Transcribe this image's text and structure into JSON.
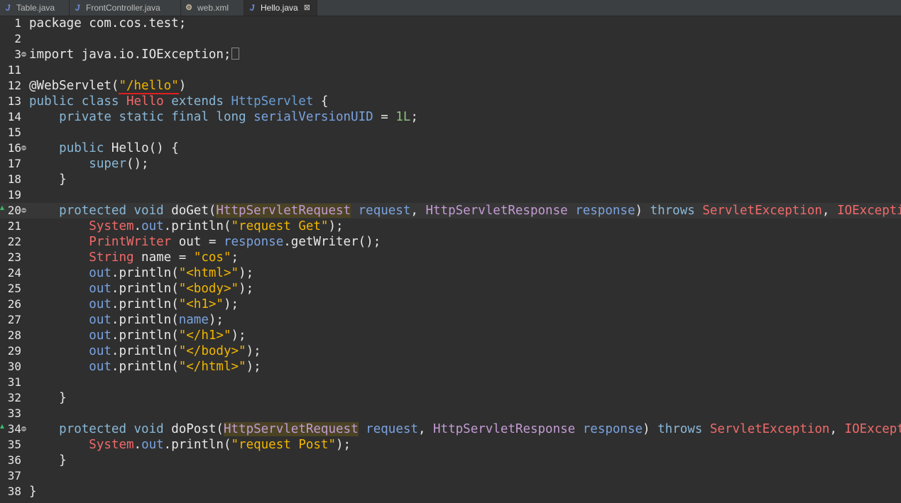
{
  "tabs": [
    {
      "icon": "J",
      "label": "Table.java"
    },
    {
      "icon": "J",
      "label": "FrontController.java"
    },
    {
      "icon": "xml",
      "label": "web.xml"
    },
    {
      "icon": "J",
      "label": "Hello.java",
      "close": "⊠"
    }
  ],
  "lines": [
    {
      "n": "1",
      "parts": [
        {
          "t": "package com.cos.test;"
        }
      ]
    },
    {
      "n": "2",
      "parts": []
    },
    {
      "n": "3",
      "parts": [
        {
          "t": "import java.io.IOException;"
        }
      ]
    },
    {
      "n": "11",
      "parts": []
    },
    {
      "n": "12",
      "parts": [
        {
          "t": "@WebServlet("
        },
        {
          "t": "\"/hello\"",
          "c": "str"
        },
        {
          "t": ")"
        }
      ]
    },
    {
      "n": "13",
      "parts": [
        {
          "t": "public class ",
          "c": "kw"
        },
        {
          "t": "Hello",
          "c": "typ"
        },
        {
          "t": " extends ",
          "c": "kw"
        },
        {
          "t": "HttpServlet",
          "c": "cls"
        },
        {
          "t": " {"
        }
      ]
    },
    {
      "n": "14",
      "parts": [
        {
          "t": "    "
        },
        {
          "t": "private static final long ",
          "c": "kw"
        },
        {
          "t": "serialVersionUID",
          "c": "var"
        },
        {
          "t": " = "
        },
        {
          "t": "1L",
          "c": "num"
        },
        {
          "t": ";"
        }
      ]
    },
    {
      "n": "15",
      "parts": []
    },
    {
      "n": "16",
      "parts": [
        {
          "t": "    "
        },
        {
          "t": "public ",
          "c": "kw"
        },
        {
          "t": "Hello() {"
        }
      ]
    },
    {
      "n": "17",
      "parts": [
        {
          "t": "        "
        },
        {
          "t": "super",
          "c": "kw"
        },
        {
          "t": "();"
        }
      ]
    },
    {
      "n": "18",
      "parts": [
        {
          "t": "    }"
        }
      ]
    },
    {
      "n": "19",
      "parts": []
    },
    {
      "n": "20",
      "parts": [
        {
          "t": "    "
        },
        {
          "t": "protected void ",
          "c": "kw"
        },
        {
          "t": "doGet("
        },
        {
          "t": "HttpServletRequest",
          "c": "tpr"
        },
        {
          "t": " "
        },
        {
          "t": "request",
          "c": "var"
        },
        {
          "t": ", "
        },
        {
          "t": "HttpServletResponse",
          "c": "tpr"
        },
        {
          "t": " "
        },
        {
          "t": "response",
          "c": "var"
        },
        {
          "t": ") "
        },
        {
          "t": "throws ",
          "c": "kw"
        },
        {
          "t": "ServletException",
          "c": "typ"
        },
        {
          "t": ", "
        },
        {
          "t": "IOException",
          "c": "typ"
        },
        {
          "t": " {"
        }
      ]
    },
    {
      "n": "21",
      "parts": [
        {
          "t": "        "
        },
        {
          "t": "System",
          "c": "typ"
        },
        {
          "t": "."
        },
        {
          "t": "out",
          "c": "var"
        },
        {
          "t": ".println("
        },
        {
          "t": "\"request Get\"",
          "c": "str"
        },
        {
          "t": ");"
        }
      ]
    },
    {
      "n": "22",
      "parts": [
        {
          "t": "        "
        },
        {
          "t": "PrintWriter",
          "c": "typ"
        },
        {
          "t": " out = "
        },
        {
          "t": "response",
          "c": "var"
        },
        {
          "t": ".getWriter();"
        }
      ]
    },
    {
      "n": "23",
      "parts": [
        {
          "t": "        "
        },
        {
          "t": "String",
          "c": "typ"
        },
        {
          "t": " name = "
        },
        {
          "t": "\"cos\"",
          "c": "str"
        },
        {
          "t": ";"
        }
      ]
    },
    {
      "n": "24",
      "parts": [
        {
          "t": "        "
        },
        {
          "t": "out",
          "c": "var"
        },
        {
          "t": ".println("
        },
        {
          "t": "\"<html>\"",
          "c": "str"
        },
        {
          "t": ");"
        }
      ]
    },
    {
      "n": "25",
      "parts": [
        {
          "t": "        "
        },
        {
          "t": "out",
          "c": "var"
        },
        {
          "t": ".println("
        },
        {
          "t": "\"<body>\"",
          "c": "str"
        },
        {
          "t": ");"
        }
      ]
    },
    {
      "n": "26",
      "parts": [
        {
          "t": "        "
        },
        {
          "t": "out",
          "c": "var"
        },
        {
          "t": ".println("
        },
        {
          "t": "\"<h1>\"",
          "c": "str"
        },
        {
          "t": ");"
        }
      ]
    },
    {
      "n": "27",
      "parts": [
        {
          "t": "        "
        },
        {
          "t": "out",
          "c": "var"
        },
        {
          "t": ".println("
        },
        {
          "t": "name",
          "c": "var"
        },
        {
          "t": ");"
        }
      ]
    },
    {
      "n": "28",
      "parts": [
        {
          "t": "        "
        },
        {
          "t": "out",
          "c": "var"
        },
        {
          "t": ".println("
        },
        {
          "t": "\"</h1>\"",
          "c": "str"
        },
        {
          "t": ");"
        }
      ]
    },
    {
      "n": "29",
      "parts": [
        {
          "t": "        "
        },
        {
          "t": "out",
          "c": "var"
        },
        {
          "t": ".println("
        },
        {
          "t": "\"</body>\"",
          "c": "str"
        },
        {
          "t": ");"
        }
      ]
    },
    {
      "n": "30",
      "parts": [
        {
          "t": "        "
        },
        {
          "t": "out",
          "c": "var"
        },
        {
          "t": ".println("
        },
        {
          "t": "\"</html>\"",
          "c": "str"
        },
        {
          "t": ");"
        }
      ]
    },
    {
      "n": "31",
      "parts": []
    },
    {
      "n": "32",
      "parts": [
        {
          "t": "    }"
        }
      ]
    },
    {
      "n": "33",
      "parts": []
    },
    {
      "n": "34",
      "parts": [
        {
          "t": "    "
        },
        {
          "t": "protected void ",
          "c": "kw"
        },
        {
          "t": "doPost("
        },
        {
          "t": "HttpServletRequest",
          "c": "tpr"
        },
        {
          "t": " "
        },
        {
          "t": "request",
          "c": "var"
        },
        {
          "t": ", "
        },
        {
          "t": "HttpServletResponse",
          "c": "tpr"
        },
        {
          "t": " "
        },
        {
          "t": "response",
          "c": "var"
        },
        {
          "t": ") "
        },
        {
          "t": "throws ",
          "c": "kw"
        },
        {
          "t": "ServletException",
          "c": "typ"
        },
        {
          "t": ", "
        },
        {
          "t": "IOException",
          "c": "typ"
        },
        {
          "t": " {"
        }
      ]
    },
    {
      "n": "35",
      "parts": [
        {
          "t": "        "
        },
        {
          "t": "System",
          "c": "typ"
        },
        {
          "t": "."
        },
        {
          "t": "out",
          "c": "var"
        },
        {
          "t": ".println("
        },
        {
          "t": "\"request Post\"",
          "c": "str"
        },
        {
          "t": ");"
        }
      ]
    },
    {
      "n": "36",
      "parts": [
        {
          "t": "    }"
        }
      ]
    },
    {
      "n": "37",
      "parts": []
    },
    {
      "n": "38",
      "parts": [
        {
          "t": "}"
        }
      ]
    }
  ],
  "colors": {
    "background": "#2f2f2f",
    "keyword": "#89b8d8",
    "string": "#f2b600",
    "type": "#f16a6a",
    "field": "#7aa3e0",
    "type_param": "#c39bd3",
    "number": "#8ec07c",
    "annotation_underline": "#e02020"
  },
  "current_line": "20",
  "folded_import_line": "3",
  "fold_markers": [
    "3",
    "16",
    "20",
    "34"
  ],
  "override_markers": [
    "20",
    "34"
  ]
}
